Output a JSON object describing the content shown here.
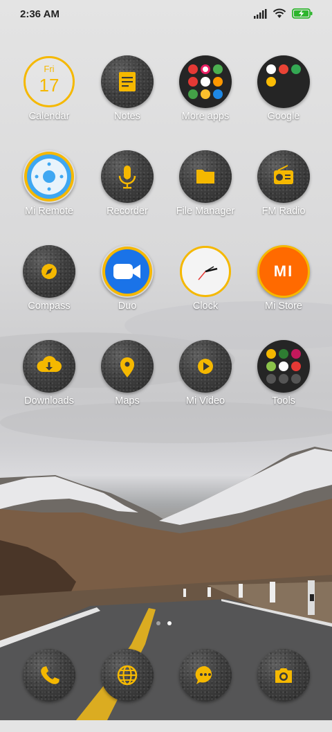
{
  "status_bar": {
    "time": "2:36 AM",
    "icons": [
      "signal-icon",
      "wifi-icon",
      "battery-charging-icon"
    ]
  },
  "calendar": {
    "weekday": "Fri",
    "day": "17"
  },
  "apps": [
    {
      "label": "Calendar",
      "icon": "calendar-icon"
    },
    {
      "label": "Notes",
      "icon": "notes-icon"
    },
    {
      "label": "More apps",
      "icon": "folder-icon"
    },
    {
      "label": "Google",
      "icon": "folder-icon"
    },
    {
      "label": "Mi Remote",
      "icon": "remote-icon"
    },
    {
      "label": "Recorder",
      "icon": "microphone-icon"
    },
    {
      "label": "File Manager",
      "icon": "folder-file-icon"
    },
    {
      "label": "FM Radio",
      "icon": "radio-icon"
    },
    {
      "label": "Compass",
      "icon": "compass-icon"
    },
    {
      "label": "Duo",
      "icon": "video-camera-icon"
    },
    {
      "label": "Clock",
      "icon": "clock-icon"
    },
    {
      "label": "Mi Store",
      "icon": "mi-logo-icon"
    },
    {
      "label": "Downloads",
      "icon": "cloud-download-icon"
    },
    {
      "label": "Maps",
      "icon": "map-pin-icon"
    },
    {
      "label": "Mi Video",
      "icon": "play-icon"
    },
    {
      "label": "Tools",
      "icon": "folder-icon"
    }
  ],
  "mi_store_logo": "MI",
  "page_indicator": {
    "pages": 2,
    "current": 2
  },
  "dock": [
    {
      "name": "phone",
      "icon": "phone-icon"
    },
    {
      "name": "browser",
      "icon": "globe-icon"
    },
    {
      "name": "messages",
      "icon": "chat-icon"
    },
    {
      "name": "camera",
      "icon": "camera-icon"
    }
  ],
  "colors": {
    "accent": "#F5B800",
    "duo_blue": "#1A73E8",
    "mi_orange": "#FF6A00",
    "icon_dark": "#3A3A3A"
  }
}
